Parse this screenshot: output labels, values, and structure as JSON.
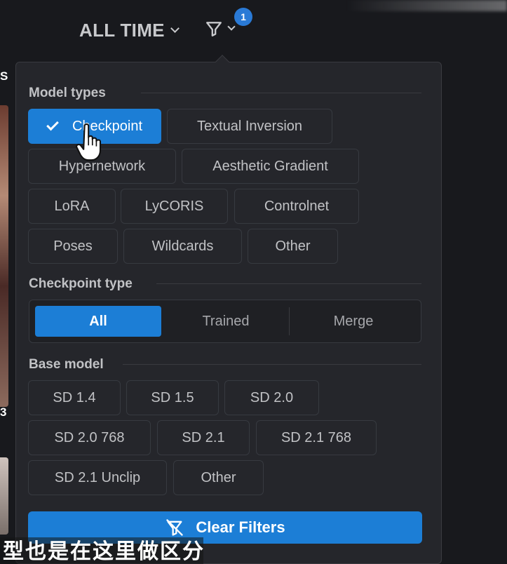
{
  "header": {
    "sort_label": "ALL TIME",
    "filter_badge_count": "1"
  },
  "filters": {
    "model_types": {
      "title": "Model types",
      "items": [
        {
          "label": "Checkpoint",
          "selected": true
        },
        {
          "label": "Textual Inversion",
          "selected": false
        },
        {
          "label": "Hypernetwork",
          "selected": false
        },
        {
          "label": "Aesthetic Gradient",
          "selected": false
        },
        {
          "label": "LoRA",
          "selected": false
        },
        {
          "label": "LyCORIS",
          "selected": false
        },
        {
          "label": "Controlnet",
          "selected": false
        },
        {
          "label": "Poses",
          "selected": false
        },
        {
          "label": "Wildcards",
          "selected": false
        },
        {
          "label": "Other",
          "selected": false
        }
      ]
    },
    "checkpoint_type": {
      "title": "Checkpoint type",
      "options": [
        "All",
        "Trained",
        "Merge"
      ],
      "selected": "All"
    },
    "base_model": {
      "title": "Base model",
      "items": [
        "SD 1.4",
        "SD 1.5",
        "SD 2.0",
        "SD 2.0 768",
        "SD 2.1",
        "SD 2.1 768",
        "SD 2.1 Unclip",
        "Other"
      ]
    },
    "clear_label": "Clear Filters"
  },
  "subtitle": "型也是在这里做区分",
  "colors": {
    "accent": "#1c7ed6",
    "panel": "#25262b",
    "border": "#373a40",
    "text": "#c1c2c5"
  }
}
